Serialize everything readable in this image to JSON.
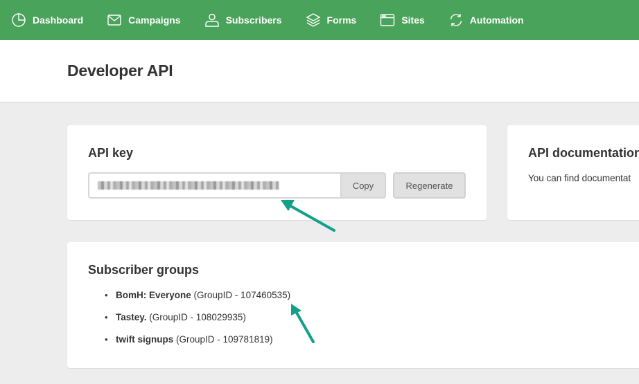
{
  "nav": {
    "items": [
      {
        "label": "Dashboard",
        "icon": "pie-chart-icon"
      },
      {
        "label": "Campaigns",
        "icon": "envelope-icon"
      },
      {
        "label": "Subscribers",
        "icon": "user-icon"
      },
      {
        "label": "Forms",
        "icon": "layers-icon"
      },
      {
        "label": "Sites",
        "icon": "browser-window-icon"
      },
      {
        "label": "Automation",
        "icon": "refresh-icon"
      }
    ],
    "bg_color": "#4aa35a"
  },
  "page": {
    "title": "Developer API"
  },
  "api_key": {
    "title": "API key",
    "value_hidden": "(pixelated / redacted)",
    "copy_label": "Copy",
    "regenerate_label": "Regenerate"
  },
  "docs": {
    "title": "API documentation",
    "text": "You can find documentat"
  },
  "groups": {
    "title": "Subscriber groups",
    "items": [
      {
        "name": "BomH: Everyone",
        "detail": "(GroupID - 107460535)"
      },
      {
        "name": "Tastey.",
        "detail": "(GroupID - 108029935)"
      },
      {
        "name": "twift signups",
        "detail": "(GroupID - 109781819)"
      }
    ]
  },
  "annotations": {
    "arrow_color": "#12a08a"
  }
}
